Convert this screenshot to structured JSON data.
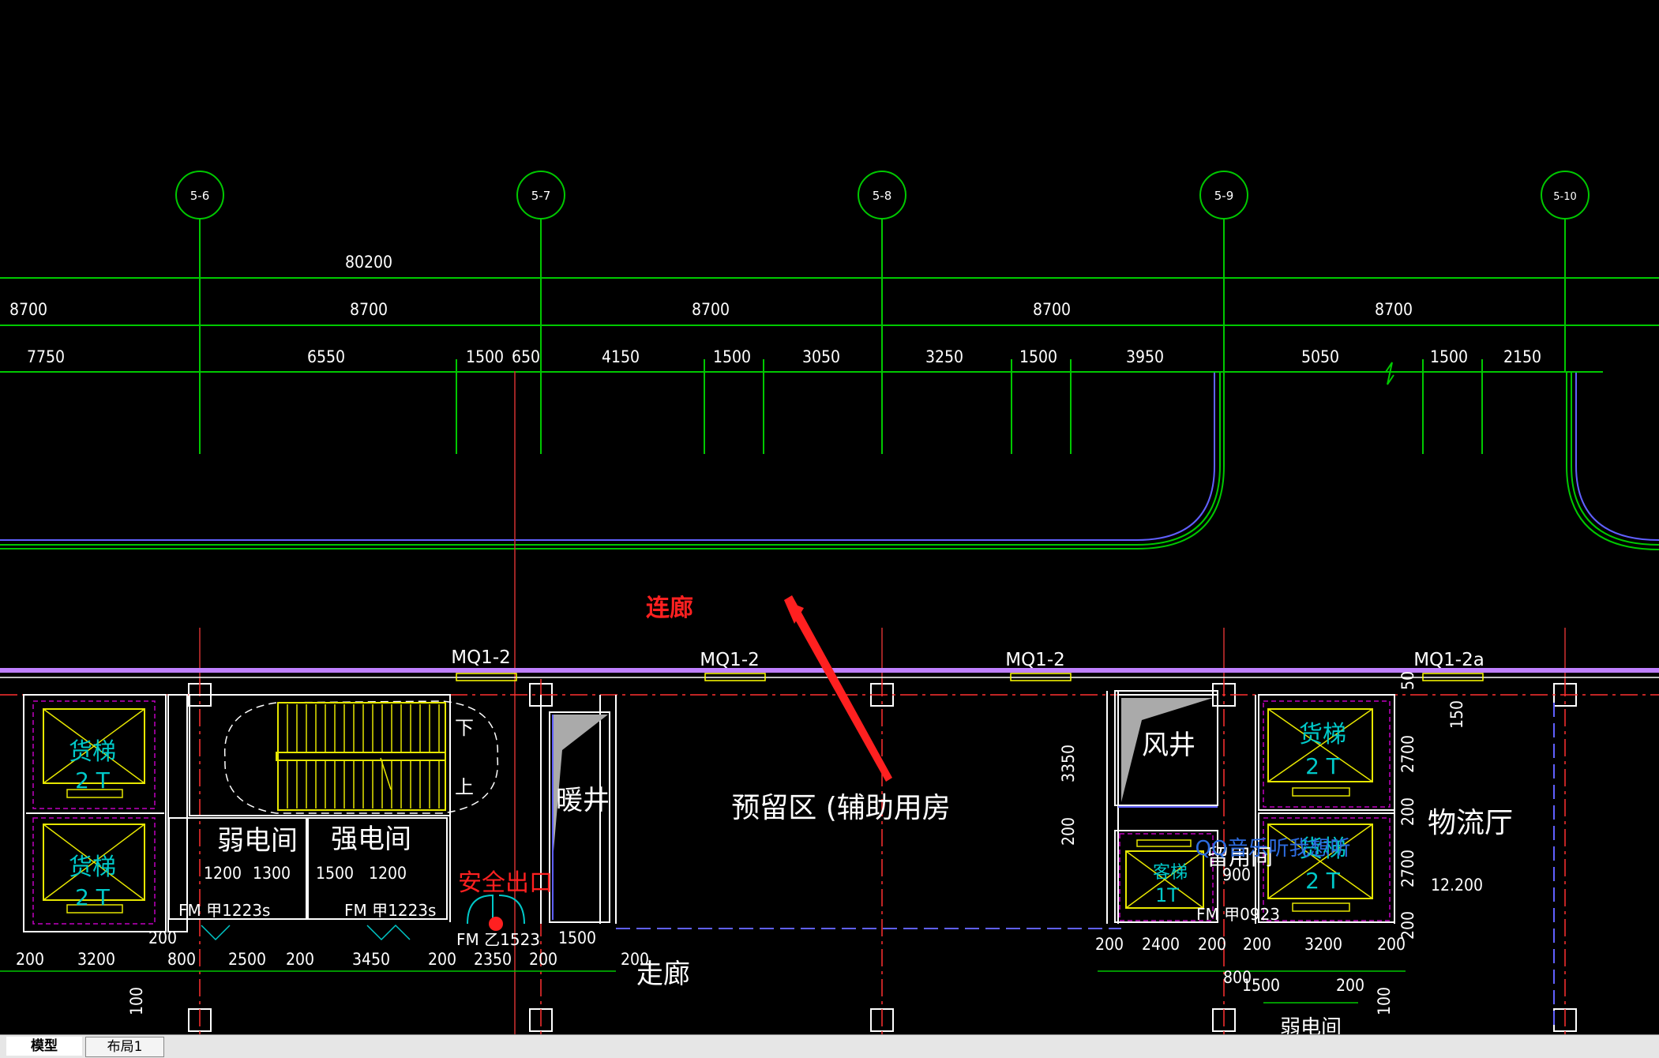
{
  "colors": {
    "background": "#000000",
    "grid_line": "#00c800",
    "wall": "#ffffff",
    "curtain_wall": "#c080ff",
    "annotation_red": "#ff2020",
    "elevator_yellow": "#e6e600",
    "cyan_text": "#00c8c8",
    "dashed_magenta": "#c000c0"
  },
  "axes": [
    {
      "label": "5-6"
    },
    {
      "label": "5-7"
    },
    {
      "label": "5-8"
    },
    {
      "label": "5-9"
    },
    {
      "label": "5-10"
    }
  ],
  "dimensions": {
    "overall": "80200",
    "bay_row": [
      "8700",
      "8700",
      "8700",
      "8700",
      "8700"
    ],
    "detail_row": [
      "7750",
      "6550",
      "1500",
      "650",
      "4150",
      "1500",
      "3050",
      "3250",
      "1500",
      "3950",
      "5050",
      "1500",
      "2150"
    ],
    "bottom_left": [
      "200",
      "3200",
      "800",
      "2500",
      "200",
      "3450",
      "200",
      "2350",
      "200",
      "1500",
      "200"
    ],
    "bottom_right": [
      "200",
      "2400",
      "200",
      "200",
      "3200",
      "200"
    ],
    "misc": [
      "200",
      "1500",
      "800",
      "200",
      "100",
      "100"
    ],
    "room_doors": [
      "1200",
      "1300",
      "1500",
      "1200",
      "900"
    ],
    "vertical": [
      "3350",
      "200",
      "2700",
      "200",
      "2700",
      "200",
      "150",
      "50"
    ],
    "level": "12.200"
  },
  "window_tags": [
    "MQ1-2",
    "MQ1-2",
    "MQ1-2",
    "MQ1-2a"
  ],
  "rooms": {
    "freight_elevator": "货梯",
    "elevator_code": "2 T",
    "passenger_elevator": "客梯",
    "passenger_code": "1T",
    "weak_current": "弱电间",
    "strong_current": "强电间",
    "heating_shaft": "暖井",
    "reserved_area": "预留区 (辅助用房",
    "air_shaft": "风井",
    "logistics_hall": "物流厅",
    "corridor": "走廊",
    "stair_down": "下",
    "stair_up": "上",
    "partial_room": "留用间",
    "partial_bottom": "弱电间"
  },
  "door_tags": {
    "fm_a1": "FM 甲1223s",
    "fm_a2": "FM 甲1223s",
    "fm_b": "FM 乙1523",
    "fm_c": "FM 甲0923"
  },
  "annotations": {
    "corridor_link": "连廊",
    "safety_exit": "安全出口",
    "qq_overlay": "QQ音乐听我想听"
  },
  "tabs": [
    {
      "label": "模型",
      "active": true
    },
    {
      "label": "布局1",
      "active": false
    }
  ]
}
